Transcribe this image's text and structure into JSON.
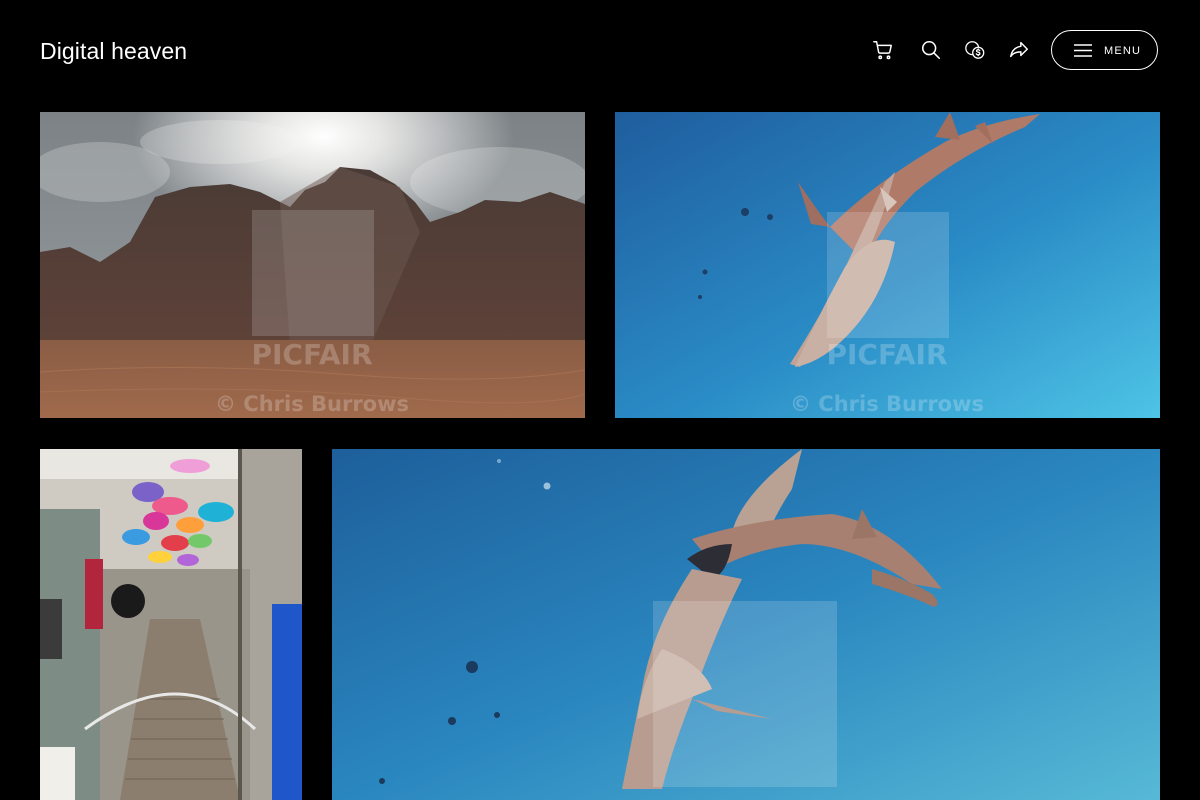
{
  "header": {
    "site_title": "Digital heaven",
    "icons": [
      "cart-icon",
      "search-icon",
      "currency-icon",
      "share-icon",
      "hamburger-icon"
    ],
    "menu_label": "MENU"
  },
  "gallery": {
    "photos": [
      {
        "subject": "desert-mountains",
        "watermark_brand": "PICFAIR",
        "watermark_credit": "© Chris Burrows"
      },
      {
        "subject": "shark-underwater",
        "watermark_brand": "PICFAIR",
        "watermark_credit": "© Chris Burrows"
      },
      {
        "subject": "umbrella-alley"
      },
      {
        "subject": "shark-underwater-large"
      }
    ]
  },
  "colors": {
    "background": "#000000",
    "text": "#ffffff",
    "accent_ocean": "#2f8fc4"
  }
}
